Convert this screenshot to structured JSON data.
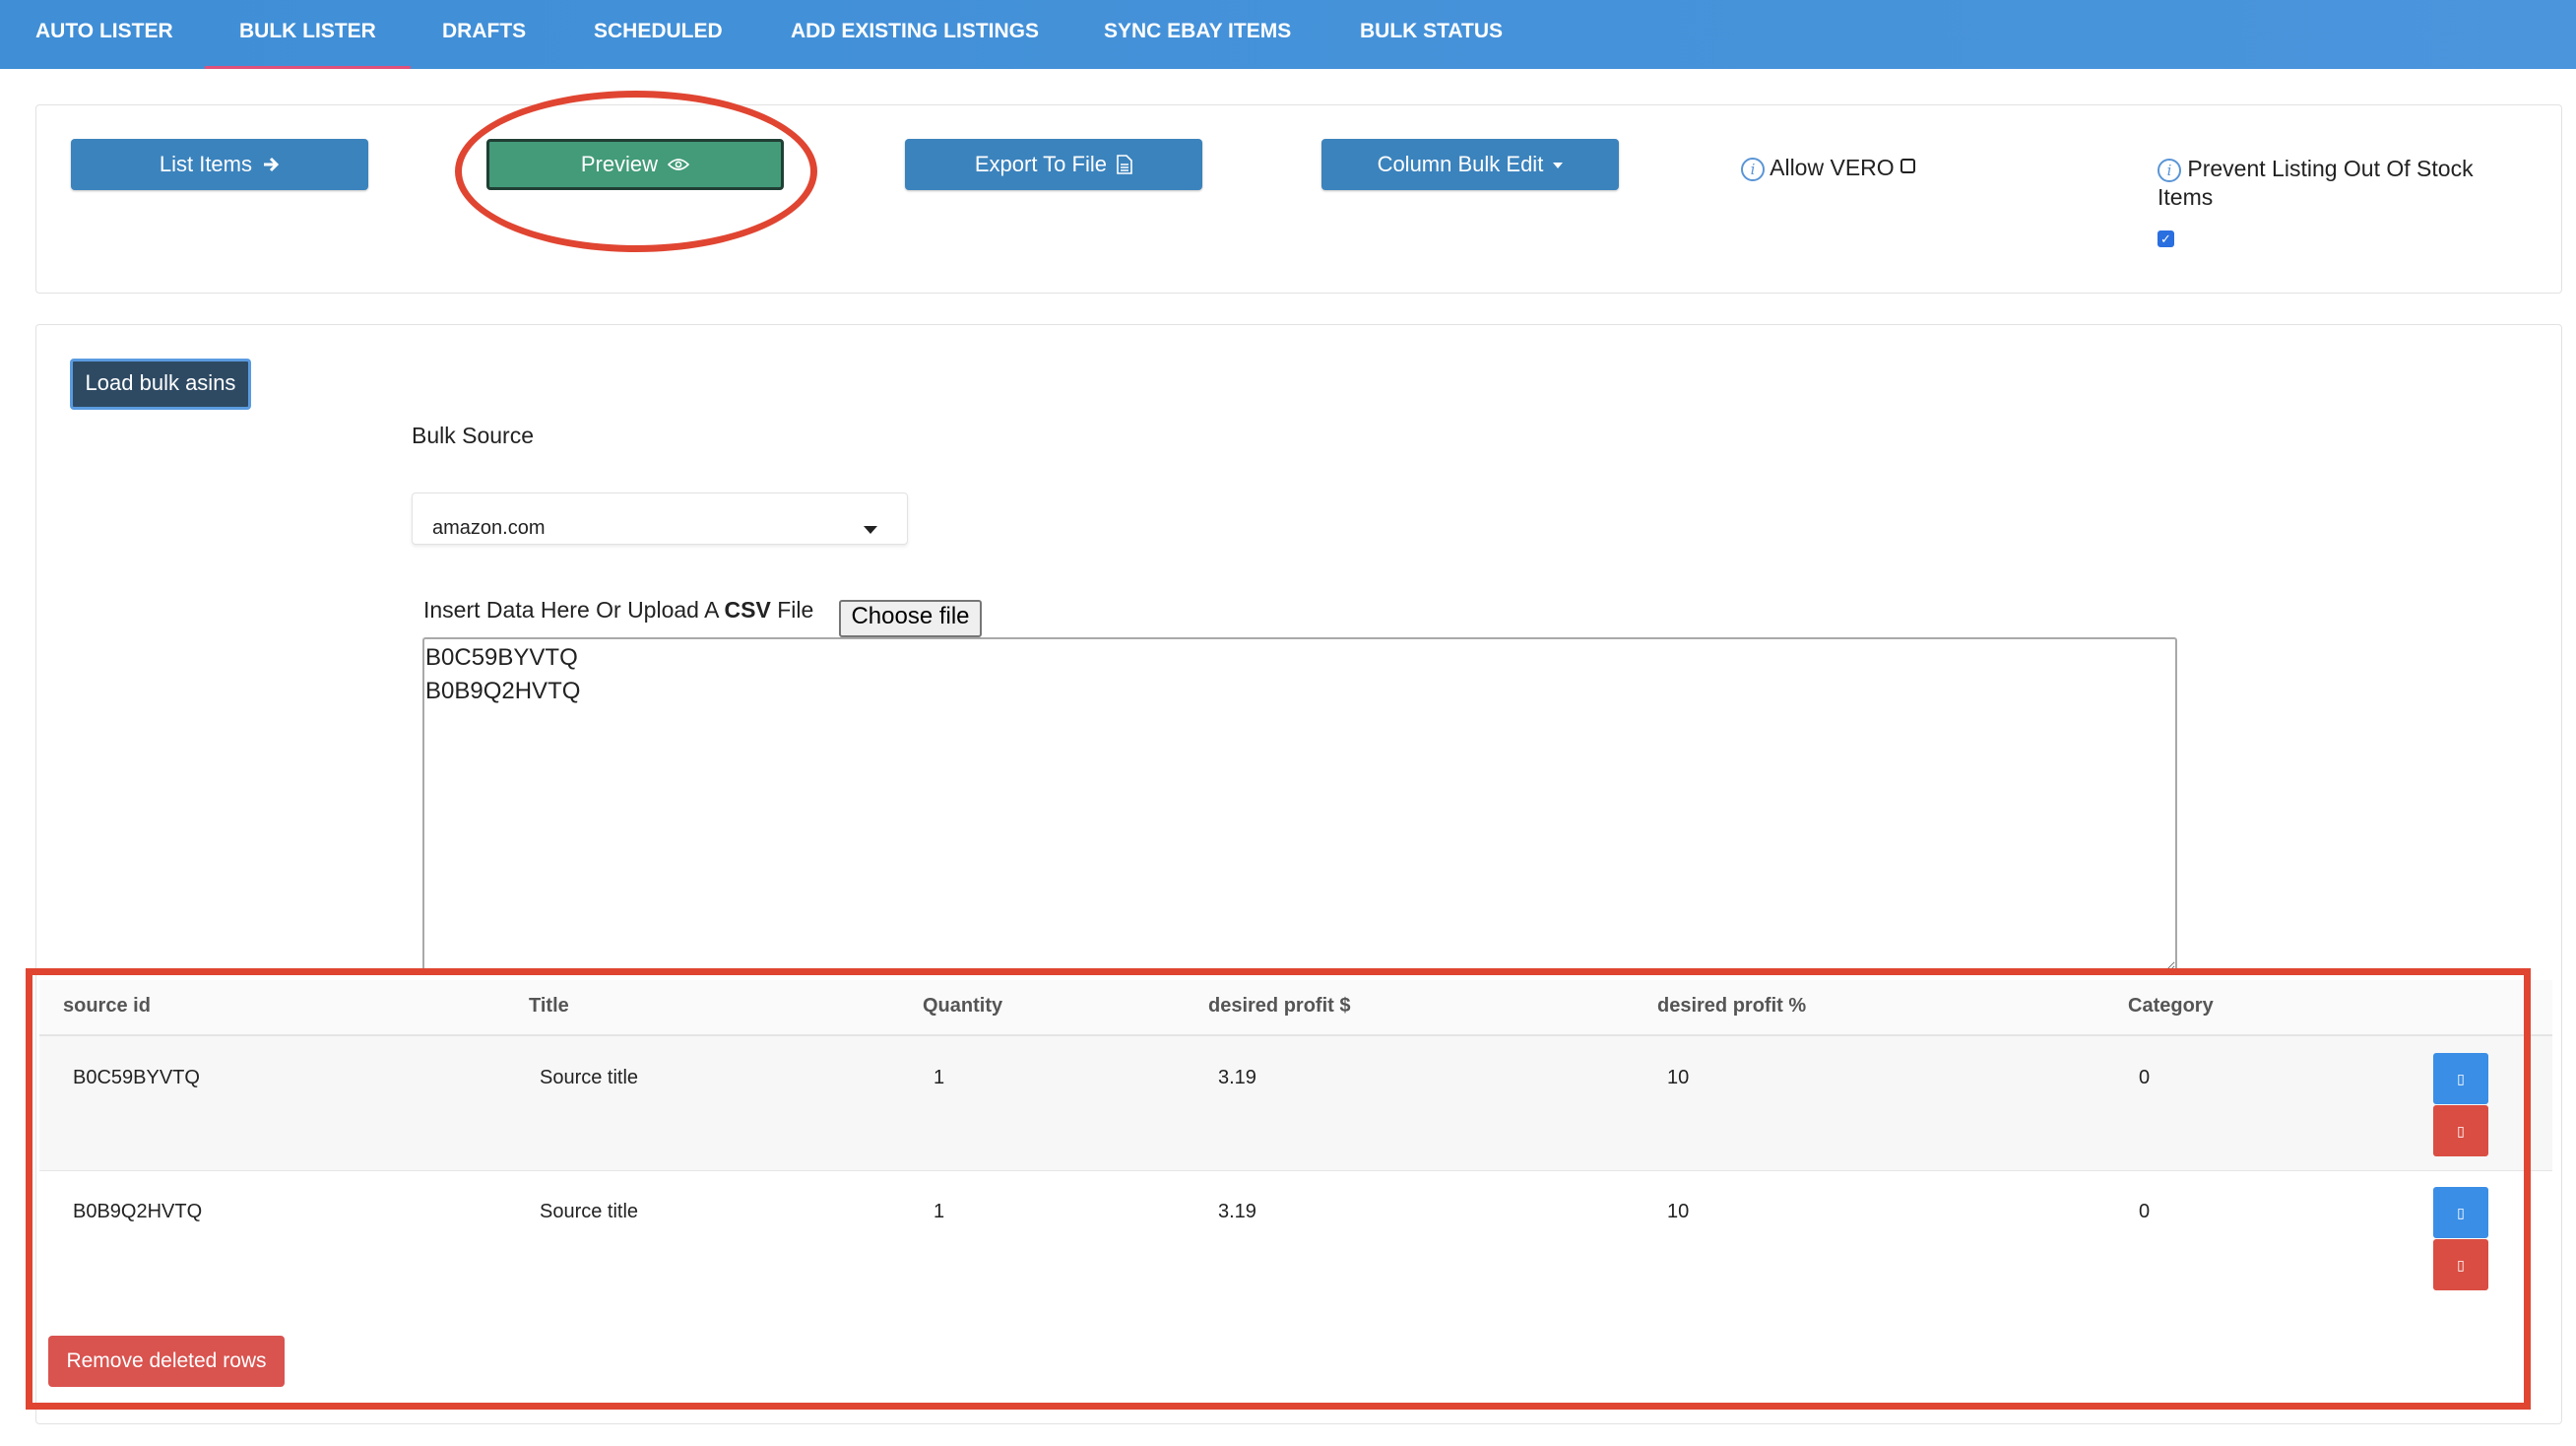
{
  "nav": {
    "tabs": [
      {
        "label": "AUTO LISTER"
      },
      {
        "label": "BULK LISTER"
      },
      {
        "label": "DRAFTS"
      },
      {
        "label": "SCHEDULED"
      },
      {
        "label": "ADD EXISTING LISTINGS"
      },
      {
        "label": "SYNC EBAY ITEMS"
      },
      {
        "label": "BULK STATUS"
      }
    ],
    "active_tab": "BULK LISTER"
  },
  "toolbar": {
    "list_items_label": "List Items",
    "list_items_icon": "arrow-right-icon",
    "preview_label": "Preview",
    "preview_icon": "eye-icon",
    "export_label": "Export To File",
    "export_icon": "file-icon",
    "column_bulk_edit_label": "Column Bulk Edit",
    "allow_vero_label": "Allow VERO",
    "allow_vero_checked": false,
    "prevent_oos_label_line1": "Prevent Listing Out Of Stock",
    "prevent_oos_label_line2": "Items",
    "prevent_oos_checked": true
  },
  "loader": {
    "load_button_label": "Load bulk asins",
    "bulk_source_label": "Bulk Source",
    "bulk_source_value": "amazon.com",
    "insert_label_pre": "Insert Data Here Or Upload A ",
    "insert_label_bold": "CSV",
    "insert_label_post": " File",
    "choose_file_label": "Choose file",
    "textarea_value": "B0C59BYVTQ\nB0B9Q2HVTQ"
  },
  "table": {
    "headers": [
      "source id",
      "Title",
      "Quantity",
      "desired profit $",
      "desired profit %",
      "Category"
    ],
    "rows": [
      {
        "source_id": "B0C59BYVTQ",
        "title": "Source title",
        "quantity": "1",
        "profit_usd": "3.19",
        "profit_pct": "10",
        "category": "0"
      },
      {
        "source_id": "B0B9Q2HVTQ",
        "title": "Source title",
        "quantity": "1",
        "profit_usd": "3.19",
        "profit_pct": "10",
        "category": "0"
      }
    ],
    "row_action_icons": [
      "edit-icon",
      "delete-icon"
    ],
    "remove_deleted_label": "Remove deleted rows"
  },
  "colors": {
    "nav_bg": "#4a95dc",
    "button_blue": "#3b83bd",
    "button_green": "#439b79",
    "annotation_red": "#e04532",
    "danger_red": "#d9534f"
  }
}
